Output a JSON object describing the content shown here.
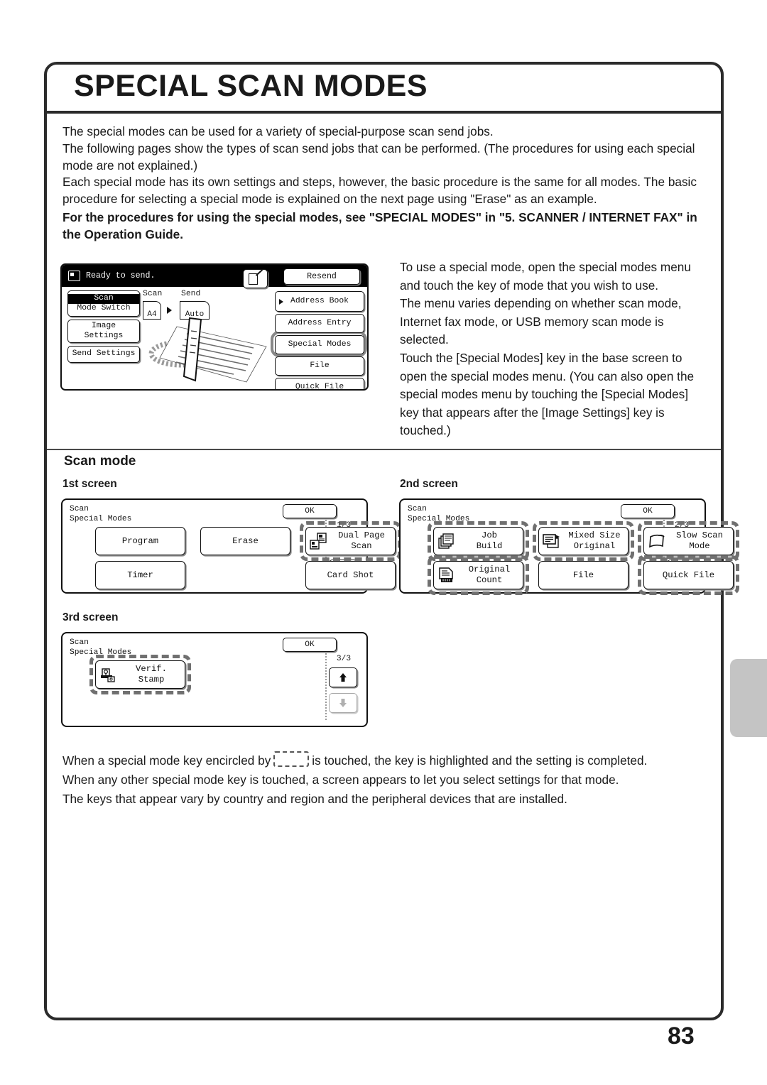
{
  "page": {
    "title": "SPECIAL SCAN MODES",
    "number": "83"
  },
  "intro": {
    "line1": "The special modes can be used for a variety of special-purpose scan send jobs.",
    "line2": "The following pages show the types of scan send jobs that can be performed. (The procedures for using each special mode are not explained.)",
    "line3": "Each special mode has its own settings and steps, however, the basic procedure is the same for all modes. The basic procedure for selecting a special mode is explained on the next page using \"Erase\" as an example.",
    "line4_bold": "For the procedures for using the special modes, see \"SPECIAL MODES\" in \"5. SCANNER / INTERNET FAX\" in the Operation Guide."
  },
  "base_screen": {
    "status_text": "Ready to send.",
    "status_icon": "document-status-icon",
    "resend_label": "Resend",
    "mode_switch": {
      "top_label": "Scan",
      "bottom_label": "Mode Switch"
    },
    "image_settings": {
      "top_label": "Image",
      "bottom_label": "Settings"
    },
    "send_settings_label": "Send Settings",
    "scan_column_label": "Scan",
    "send_column_label": "Send",
    "scan_size": "A4",
    "send_size": "Auto",
    "right_keys": [
      "Address Book",
      "Address Entry",
      "Special Modes",
      "File",
      "Quick File"
    ],
    "highlighted_key": "Special Modes",
    "preview_icon": "preview-key-icon"
  },
  "right_body": {
    "para1": "To use a special mode, open the special modes menu and touch the key of mode that you wish to use.",
    "para2": "The menu varies depending on whether scan mode, Internet fax mode, or USB memory scan mode is selected.",
    "para3": "Touch the [Special Modes] key in the base screen to open the special modes menu. (You can also open the special modes menu by touching the [Special Modes] key that appears after the [Image Settings] key is touched.)"
  },
  "section": {
    "scan_mode_heading": "Scan mode",
    "screen1_heading": "1st screen",
    "screen2_heading": "2nd screen",
    "screen3_heading": "3rd screen"
  },
  "screens": [
    {
      "id": "screen-1",
      "title_line1": "Scan",
      "title_line2": "Special Modes",
      "ok_label": "OK",
      "page_indicator": "1/3",
      "up_enabled": false,
      "down_enabled": true,
      "keys": [
        {
          "label": "Program",
          "col": 1,
          "row": 1,
          "dashed": false,
          "icon": ""
        },
        {
          "label": "Erase",
          "col": 2,
          "row": 1,
          "dashed": false,
          "icon": ""
        },
        {
          "label": "Dual Page\nScan",
          "col": 3,
          "row": 1,
          "dashed": true,
          "icon": "dual-page-scan-icon"
        },
        {
          "label": "Timer",
          "col": 1,
          "row": 2,
          "dashed": false,
          "icon": ""
        },
        {
          "label": "Card Shot",
          "col": 3,
          "row": 2,
          "dashed": false,
          "icon": ""
        }
      ]
    },
    {
      "id": "screen-2",
      "title_line1": "Scan",
      "title_line2": "Special Modes",
      "ok_label": "OK",
      "page_indicator": "2/3",
      "up_enabled": true,
      "down_enabled": true,
      "keys": [
        {
          "label": "Job\nBuild",
          "col": 1,
          "row": 1,
          "dashed": true,
          "icon": "job-build-icon"
        },
        {
          "label": "Mixed Size\nOriginal",
          "col": 2,
          "row": 1,
          "dashed": true,
          "icon": "mixed-size-original-icon"
        },
        {
          "label": "Slow Scan\nMode",
          "col": 3,
          "row": 1,
          "dashed": true,
          "icon": "slow-scan-mode-icon"
        },
        {
          "label": "Original\nCount",
          "col": 1,
          "row": 2,
          "dashed": true,
          "icon": "original-count-icon"
        },
        {
          "label": "File",
          "col": 2,
          "row": 2,
          "dashed": false,
          "icon": ""
        },
        {
          "label": "Quick File",
          "col": 3,
          "row": 2,
          "dashed": true,
          "icon": ""
        }
      ]
    },
    {
      "id": "screen-3",
      "title_line1": "Scan",
      "title_line2": "Special Modes",
      "ok_label": "OK",
      "page_indicator": "3/3",
      "up_enabled": true,
      "down_enabled": false,
      "keys": [
        {
          "label": "Verif.\nStamp",
          "col": 1,
          "row": 1,
          "dashed": true,
          "icon": "verif-stamp-icon"
        }
      ]
    }
  ],
  "footer": {
    "line1_before": "When a special mode key encircled by",
    "line1_after": "is touched, the key is highlighted and the setting is completed.",
    "line2": "When any other special mode key is touched, a screen appears to let you select settings for that mode.",
    "line3": "The keys that appear vary by country and region and the peripheral devices that are installed."
  }
}
